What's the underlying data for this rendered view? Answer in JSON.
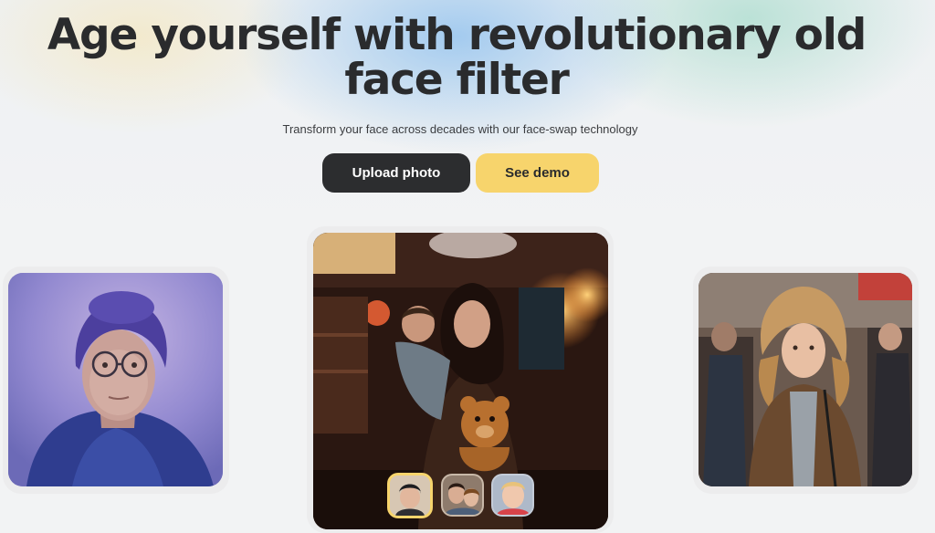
{
  "hero": {
    "title_line1": "Age yourself with revolutionary old",
    "title_line2": "face filter",
    "subtitle": "Transform your face across decades with our face-swap technology"
  },
  "actions": {
    "upload_label": "Upload photo",
    "demo_label": "See demo"
  },
  "colors": {
    "primary_button": "#2c2d2f",
    "secondary_button": "#f7d46c",
    "active_thumb_border": "#f7d46c"
  },
  "gallery": {
    "active_thumbnail": 1
  }
}
